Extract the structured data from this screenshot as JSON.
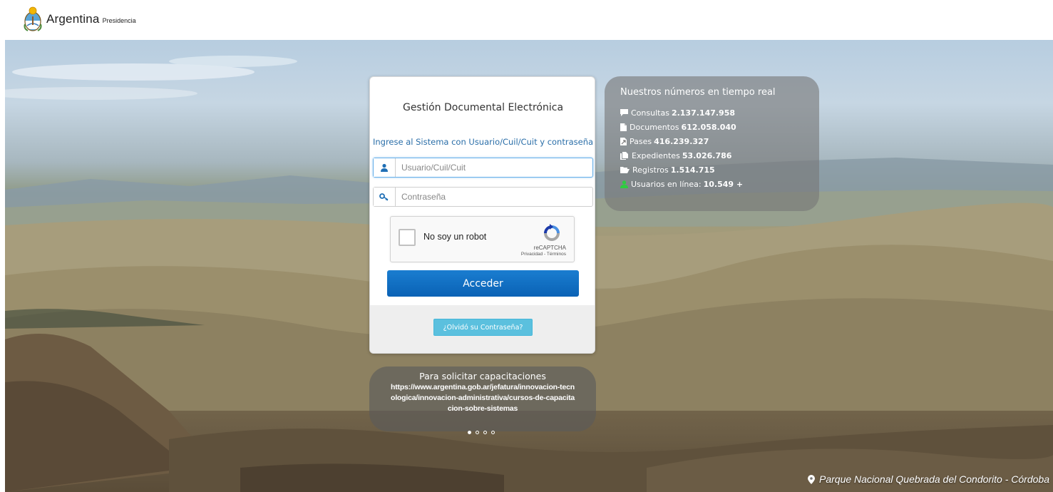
{
  "header": {
    "logo_icon": "argentina-coat-of-arms-icon",
    "brand_name": "Argentina",
    "brand_sub": "Presidencia"
  },
  "login": {
    "title": "Gestión Documental Electrónica",
    "subtitle": "Ingrese al Sistema con Usuario/Cuil/Cuit y contraseña",
    "user_icon": "user-icon",
    "user_placeholder": "Usuario/Cuil/Cuit",
    "user_value": "",
    "password_icon": "key-icon",
    "password_placeholder": "Contraseña",
    "password_value": "",
    "recaptcha": {
      "label": "No soy un robot",
      "brand": "reCAPTCHA",
      "links": "Privacidad - Términos",
      "checked": false
    },
    "submit_label": "Acceder",
    "forgot_label": "¿Olvidó su Contraseña?"
  },
  "stats": {
    "title": "Nuestros números en tiempo real",
    "items": [
      {
        "icon": "comment-icon",
        "label": "Consultas",
        "value": "2.137.147.958"
      },
      {
        "icon": "file-icon",
        "label": "Documentos",
        "value": "612.058.040"
      },
      {
        "icon": "file-arrow-icon",
        "label": "Pases",
        "value": "416.239.327"
      },
      {
        "icon": "files-icon",
        "label": "Expedientes",
        "value": "53.026.786"
      },
      {
        "icon": "folder-open-icon",
        "label": "Registros",
        "value": "1.514.715"
      },
      {
        "icon": "user-online-icon",
        "label": "Usuarios en línea:",
        "value": "10.549 +"
      }
    ]
  },
  "training": {
    "title": "Para solicitar capacitaciones",
    "link": "https://www.argentina.gob.ar/jefatura/innovacion-tecnologica/innovacion-administrativa/cursos-de-capacitacion-sobre-sistemas"
  },
  "carousel": {
    "total": 4,
    "active_index": 0
  },
  "location": {
    "icon": "map-marker-icon",
    "text": "Parque Nacional Quebrada del Condorito - Córdoba"
  },
  "colors": {
    "primary_button": "#0a62b5",
    "info_button": "#5bc0de",
    "link_blue": "#2a6ea8",
    "online_green": "#2ecc40"
  }
}
